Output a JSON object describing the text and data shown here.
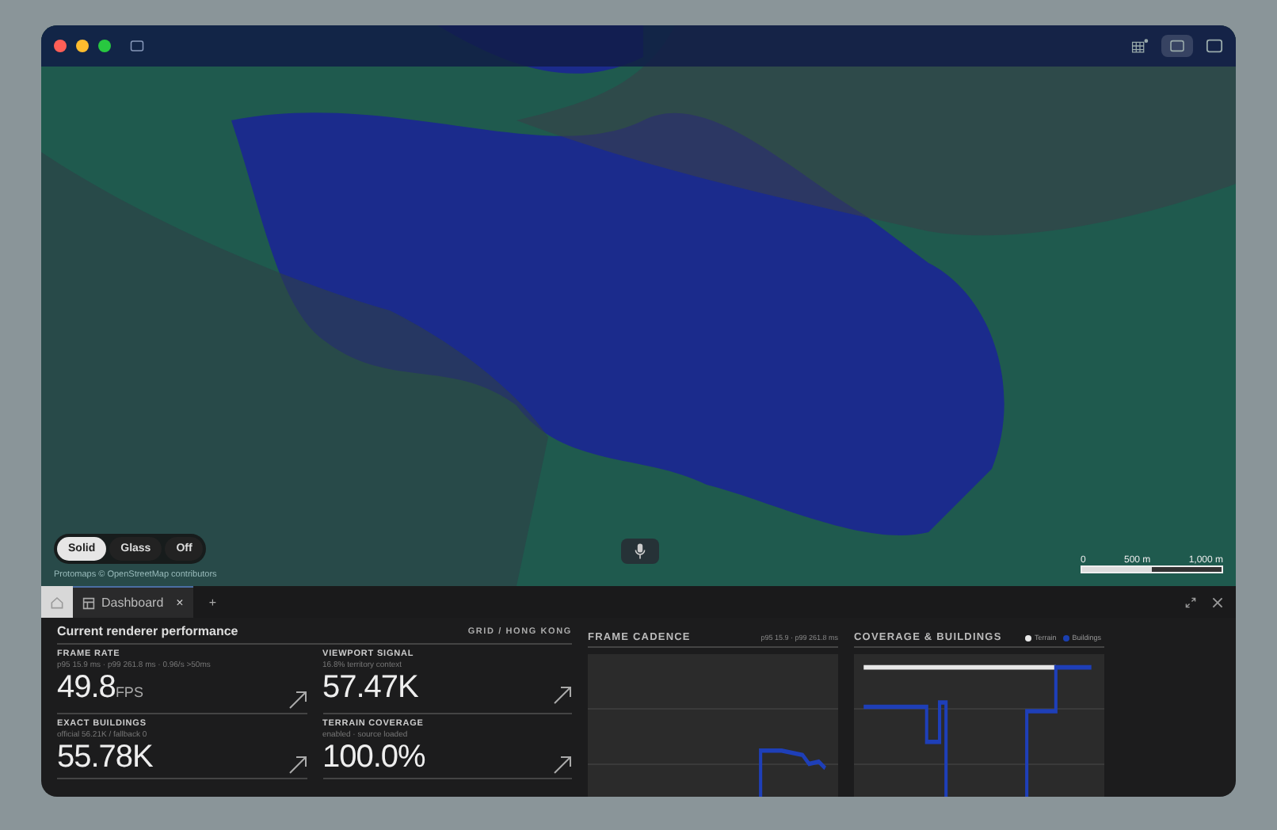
{
  "map": {
    "style_options": [
      {
        "label": "Solid",
        "selected": true
      },
      {
        "label": "Glass",
        "selected": false
      },
      {
        "label": "Off",
        "selected": false
      }
    ],
    "attribution": "Protomaps © OpenStreetMap contributors",
    "scale": [
      "0",
      "500 m",
      "1,000 m"
    ]
  },
  "tabs": [
    {
      "kind": "home",
      "selected": false
    },
    {
      "kind": "page",
      "label": "Dashboard",
      "close": "×",
      "selected": true
    }
  ],
  "add_tab": "+",
  "dashboard": {
    "title": "Current renderer performance",
    "context": "GRID / HONG KONG",
    "metrics": [
      {
        "label": "FRAME RATE",
        "detail": "p95 15.9 ms · p99 261.8 ms · 0.96/s >50ms",
        "value": "49.8",
        "unit": "FPS"
      },
      {
        "label": "VIEWPORT SIGNAL",
        "detail": "16.8% territory context",
        "value": "57.47K"
      },
      {
        "label": "EXACT BUILDINGS",
        "detail": "official 56.21K / fallback 0",
        "value": "55.78K"
      },
      {
        "label": "TERRAIN COVERAGE",
        "detail": "enabled · source loaded",
        "value": "100.0%"
      }
    ]
  },
  "panels": [
    {
      "title": "FRAME CADENCE",
      "note": "p95 15.9 · p99 261.8 ms"
    },
    {
      "title": "COVERAGE & BUILDINGS",
      "legend": [
        {
          "label": "Terrain",
          "color": "#e8e8e8"
        },
        {
          "label": "Buildings",
          "color": "#1a3fb0"
        }
      ]
    }
  ]
}
